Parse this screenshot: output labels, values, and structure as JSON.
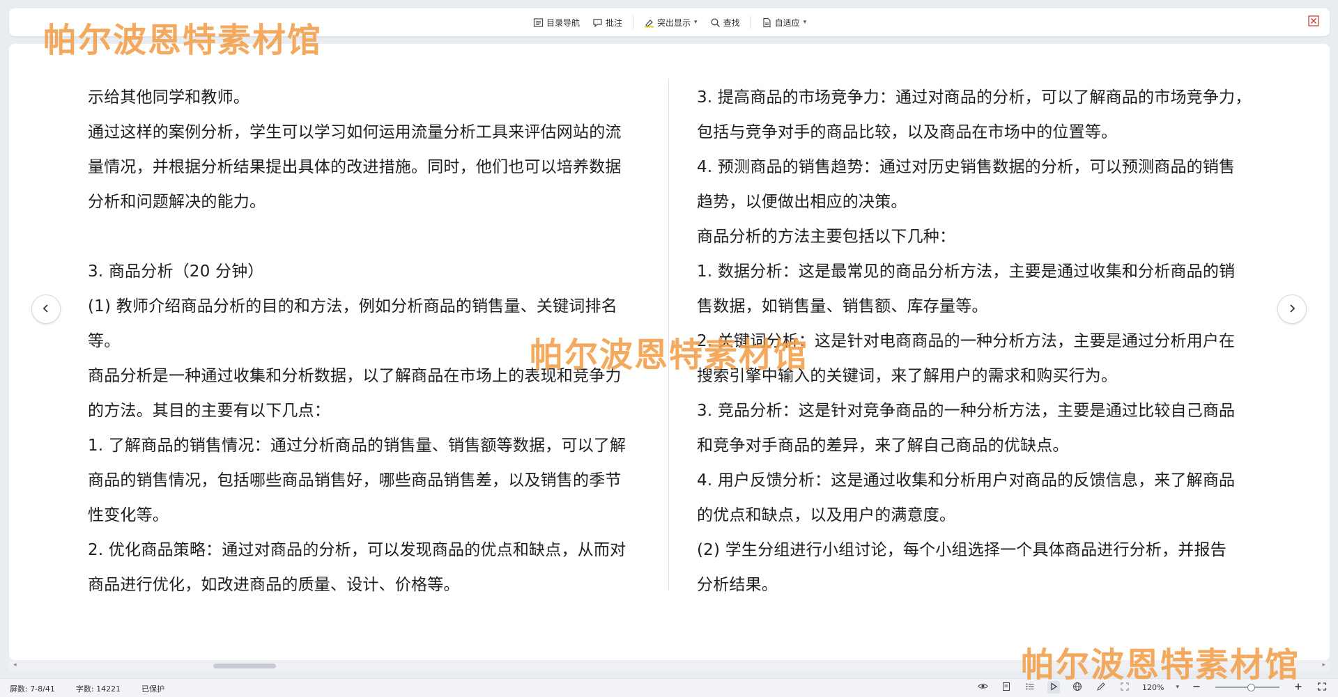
{
  "toolbar": {
    "toc_label": "目录导航",
    "comment_label": "批注",
    "highlight_label": "突出显示",
    "find_label": "查找",
    "fit_label": "自适应"
  },
  "document": {
    "left_column": [
      "示给其他同学和教师。",
      "通过这样的案例分析，学生可以学习如何运用流量分析工具来评估网站的流",
      "量情况，并根据分析结果提出具体的改进措施。同时，他们也可以培养数据",
      "分析和问题解决的能力。",
      "",
      "3. 商品分析（20 分钟）",
      "(1) 教师介绍商品分析的目的和方法，例如分析商品的销售量、关键词排名",
      "等。",
      "商品分析是一种通过收集和分析数据，以了解商品在市场上的表现和竞争力",
      "的方法。其目的主要有以下几点：",
      "1. 了解商品的销售情况：通过分析商品的销售量、销售额等数据，可以了解",
      "商品的销售情况，包括哪些商品销售好，哪些商品销售差，以及销售的季节",
      "性变化等。",
      "2. 优化商品策略：通过对商品的分析，可以发现商品的优点和缺点，从而对",
      "商品进行优化，如改进商品的质量、设计、价格等。"
    ],
    "right_column": [
      "3. 提高商品的市场竞争力：通过对商品的分析，可以了解商品的市场竞争力，",
      "包括与竞争对手的商品比较，以及商品在市场中的位置等。",
      "4. 预测商品的销售趋势：通过对历史销售数据的分析，可以预测商品的销售",
      "趋势，以便做出相应的决策。",
      "商品分析的方法主要包括以下几种：",
      "1. 数据分析：这是最常见的商品分析方法，主要是通过收集和分析商品的销",
      "售数据，如销售量、销售额、库存量等。",
      "2. 关键词分析：这是针对电商商品的一种分析方法，主要是通过分析用户在",
      "搜索引擎中输入的关键词，来了解用户的需求和购买行为。",
      "3. 竞品分析：这是针对竞争商品的一种分析方法，主要是通过比较自己商品",
      "和竞争对手商品的差异，来了解自己商品的优缺点。",
      "4. 用户反馈分析：这是通过收集和分析用户对商品的反馈信息，来了解商品",
      "的优点和缺点，以及用户的满意度。",
      "(2) 学生分组进行小组讨论，每个小组选择一个具体商品进行分析，并报告",
      "分析结果。"
    ]
  },
  "watermark": {
    "text": "帕尔波恩特素材馆"
  },
  "statusbar": {
    "pages": "屏数: 7-8/41",
    "word_count": "字数: 14221",
    "protection": "已保护",
    "zoom": "120%",
    "zoom_level": 0.55
  },
  "colors": {
    "background": "#e9ecf1",
    "page": "#ffffff",
    "text": "#1f1f1f",
    "watermark": "#f29e48"
  }
}
